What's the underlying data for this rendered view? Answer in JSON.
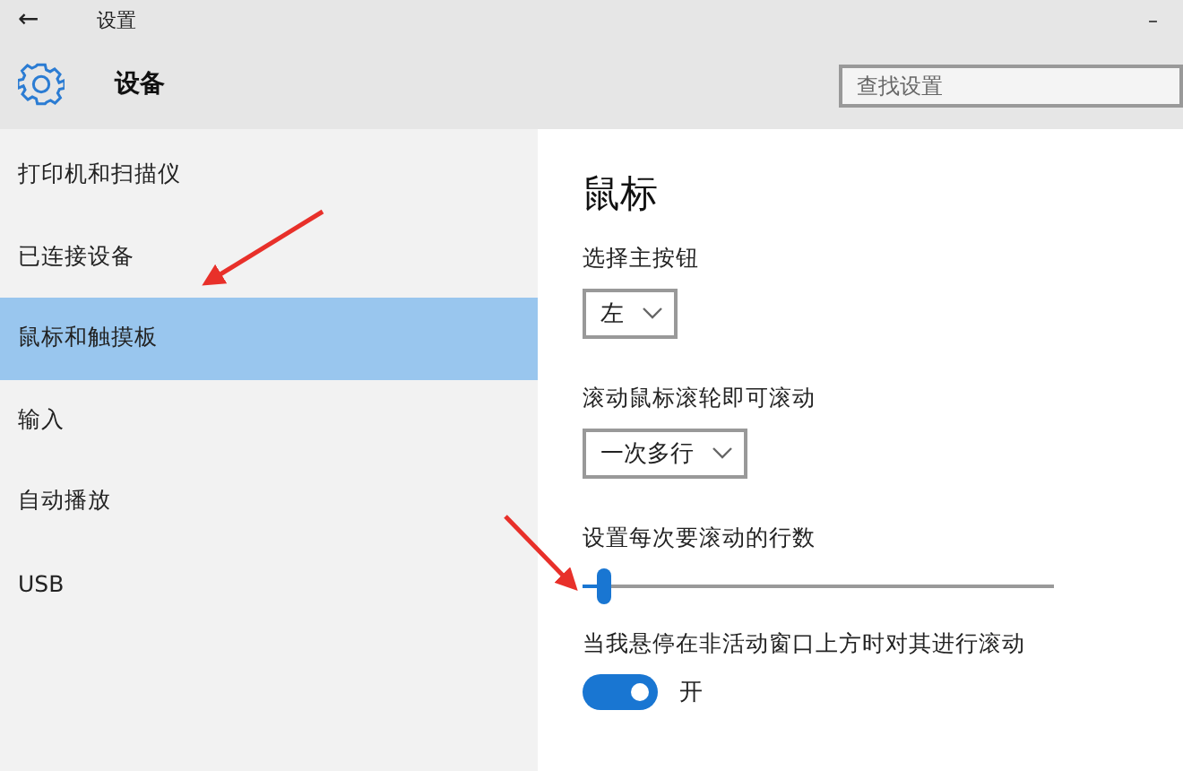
{
  "window": {
    "title": "设置",
    "back": "←",
    "minimize": "–"
  },
  "header": {
    "title": "设备"
  },
  "search": {
    "placeholder": "查找设置"
  },
  "sidebar": {
    "items": [
      {
        "label": "打印机和扫描仪",
        "selected": false
      },
      {
        "label": "已连接设备",
        "selected": false
      },
      {
        "label": "鼠标和触摸板",
        "selected": true
      },
      {
        "label": "输入",
        "selected": false
      },
      {
        "label": "自动播放",
        "selected": false
      },
      {
        "label": "USB",
        "selected": false
      }
    ]
  },
  "content": {
    "title": "鼠标",
    "settings": [
      {
        "kind": "dropdown",
        "label": "选择主按钮",
        "value": "左"
      },
      {
        "kind": "dropdown",
        "label": "滚动鼠标滚轮即可滚动",
        "value": "一次多行"
      },
      {
        "kind": "slider",
        "label": "设置每次要滚动的行数",
        "level": 0.03
      },
      {
        "kind": "toggle",
        "label": "当我悬停在非活动窗口上方时对其进行滚动",
        "on": true,
        "state": "开"
      }
    ]
  }
}
